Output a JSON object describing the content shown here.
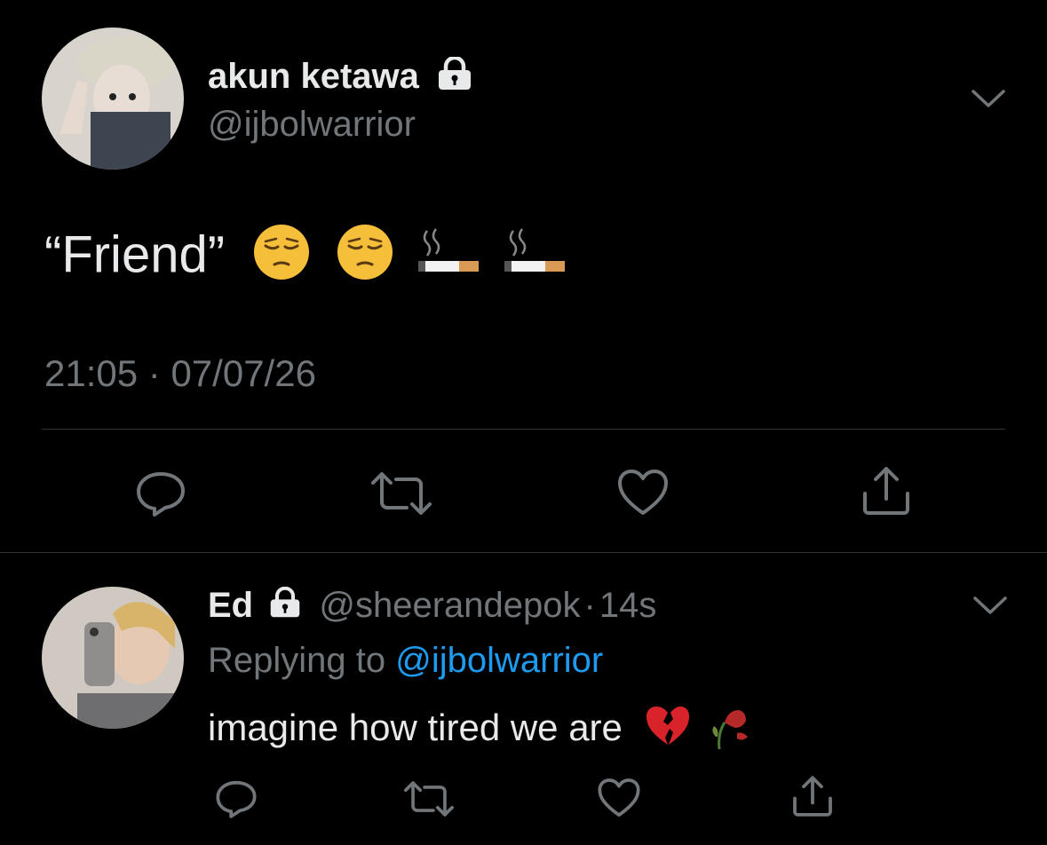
{
  "main_tweet": {
    "display_name": "akun ketawa",
    "handle": "@ijbolwarrior",
    "text_quote": "“Friend”",
    "emojis": [
      "pensive-face",
      "pensive-face",
      "cigarette",
      "cigarette"
    ],
    "time": "21:05",
    "separator": "·",
    "date": "07/07/26",
    "icons": [
      "chevron-down-icon",
      "lock-icon",
      "reply-icon",
      "retweet-icon",
      "like-icon",
      "share-icon"
    ]
  },
  "reply": {
    "display_name": "Ed",
    "handle": "@sheerandepok",
    "separator": "·",
    "age": "14s",
    "replying_to_label": "Replying to",
    "replying_to_handle": "@ijbolwarrior",
    "text": "imagine how tired we are",
    "emojis": [
      "broken-heart",
      "wilted-flower"
    ]
  },
  "colors": {
    "background": "#000000",
    "text": "#e7e9ea",
    "muted": "#71767b",
    "link": "#1d9bf0",
    "divider": "#2f3336"
  }
}
